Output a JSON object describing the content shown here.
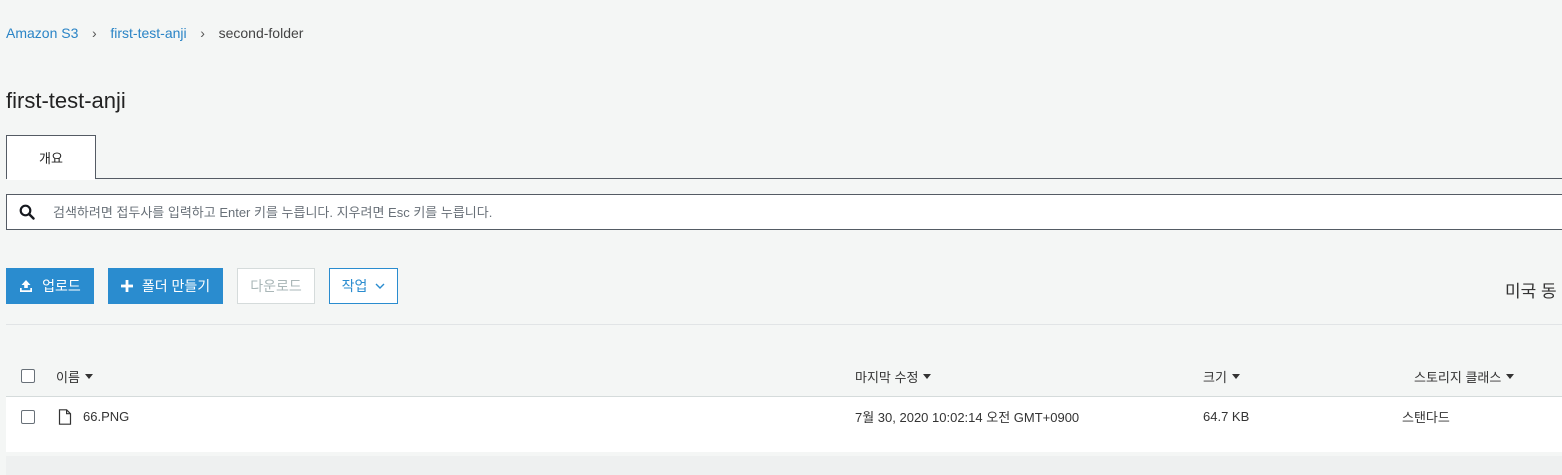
{
  "breadcrumb": {
    "root": "Amazon S3",
    "bucket": "first-test-anji",
    "current": "second-folder",
    "separator": "›"
  },
  "page_title": "first-test-anji",
  "tabs": [
    {
      "label": "개요",
      "active": true
    }
  ],
  "search": {
    "placeholder": "검색하려면 접두사를 입력하고 Enter 키를 누릅니다. 지우려면 Esc 키를 누릅니다.",
    "value": ""
  },
  "toolbar": {
    "upload_label": "업로드",
    "create_folder_label": "폴더 만들기",
    "download_label": "다운로드",
    "actions_label": "작업",
    "region": "미국 동"
  },
  "table": {
    "columns": [
      "이름",
      "마지막 수정",
      "크기",
      "스토리지 클래스"
    ],
    "rows": [
      {
        "name": "66.PNG",
        "last_modified": "7월 30, 2020 10:02:14 오전 GMT+0900",
        "size": "64.7 KB",
        "storage_class": "스탠다드"
      }
    ]
  },
  "colors": {
    "accent": "#2a8ccf",
    "link": "#2a84c6",
    "background": "#f4f6f5"
  },
  "icons": [
    "search-icon",
    "upload-icon",
    "plus-icon",
    "chevron-down-icon",
    "file-icon",
    "chevron-right-icon"
  ]
}
